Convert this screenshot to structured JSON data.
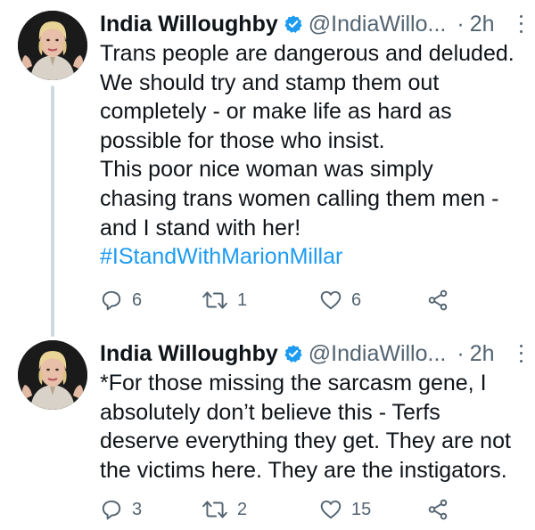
{
  "tweets": [
    {
      "author": "India Willoughby",
      "handle": "@IndiaWillo...",
      "separator": "·",
      "time": "2h",
      "lines": [
        "Trans people are dangerous and deluded.",
        "We should try and stamp them out",
        "completely - or make life as hard as",
        "possible for those who insist.",
        "This poor nice woman was simply",
        "chasing trans women calling them men -",
        "and I stand with her!"
      ],
      "hashtag": "#IStandWithMarionMillar",
      "replies": "6",
      "retweets": "1",
      "likes": "6"
    },
    {
      "author": "India Willoughby",
      "handle": "@IndiaWillo...",
      "separator": "·",
      "time": "2h",
      "lines": [
        "*For those missing the sarcasm gene, I",
        "absolutely don’t believe this - Terfs",
        "deserve everything they get. They are not",
        "the victims here. They are the instigators."
      ],
      "replies": "3",
      "retweets": "2",
      "likes": "15"
    }
  ],
  "icons": {
    "verified": "verified-badge-icon",
    "reply": "reply-icon",
    "retweet": "retweet-icon",
    "like": "heart-icon",
    "share": "share-icon",
    "more": "more-icon"
  },
  "colors": {
    "accent": "#1d9bf0",
    "text": "#0f1419",
    "secondary": "#536471",
    "thread_line": "#cfd9de"
  }
}
